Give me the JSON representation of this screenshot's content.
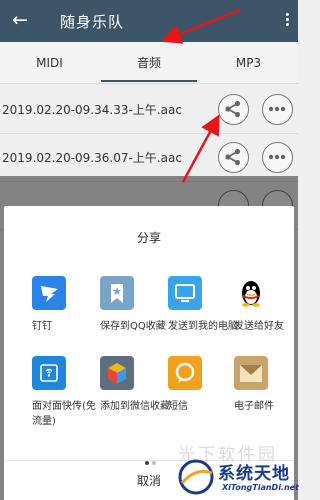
{
  "app_bar": {
    "title": "随身乐队"
  },
  "tabs": [
    {
      "label": "MIDI"
    },
    {
      "label": "音频"
    },
    {
      "label": "MP3"
    }
  ],
  "files": [
    {
      "name": "2019.02.20-09.34.33-上午.aac"
    },
    {
      "name": "2019.02.20-09.36.07-上午.aac"
    },
    {
      "name": ""
    }
  ],
  "share_sheet": {
    "title": "分享",
    "items": [
      {
        "label": "钉钉",
        "icon": "dingtalk-icon",
        "color": "#2a84e8"
      },
      {
        "label": "保存到QQ收藏",
        "icon": "qq-favorite-icon",
        "color": "#7aa5c8"
      },
      {
        "label": "发送到我的电脑",
        "icon": "my-computer-icon",
        "color": "#3aa4e8"
      },
      {
        "label": "发送给好友",
        "icon": "qq-penguin-icon",
        "color": "#000000"
      },
      {
        "label": "面对面快传(免流量)",
        "icon": "face-to-face-transfer-icon",
        "color": "#1f86e0"
      },
      {
        "label": "添加到微信收藏",
        "icon": "wechat-favorite-icon",
        "color": "#5e6e7f"
      },
      {
        "label": "短信",
        "icon": "sms-icon",
        "color": "#f0a21e"
      },
      {
        "label": "电子邮件",
        "icon": "email-icon",
        "color": "#c8a46b"
      }
    ],
    "cancel_label": "取消",
    "page_count": 2,
    "current_page": 1
  },
  "watermark": {
    "text": "系统天地",
    "sub": "XiTongTianDi.net",
    "faint": "光下软件园"
  }
}
